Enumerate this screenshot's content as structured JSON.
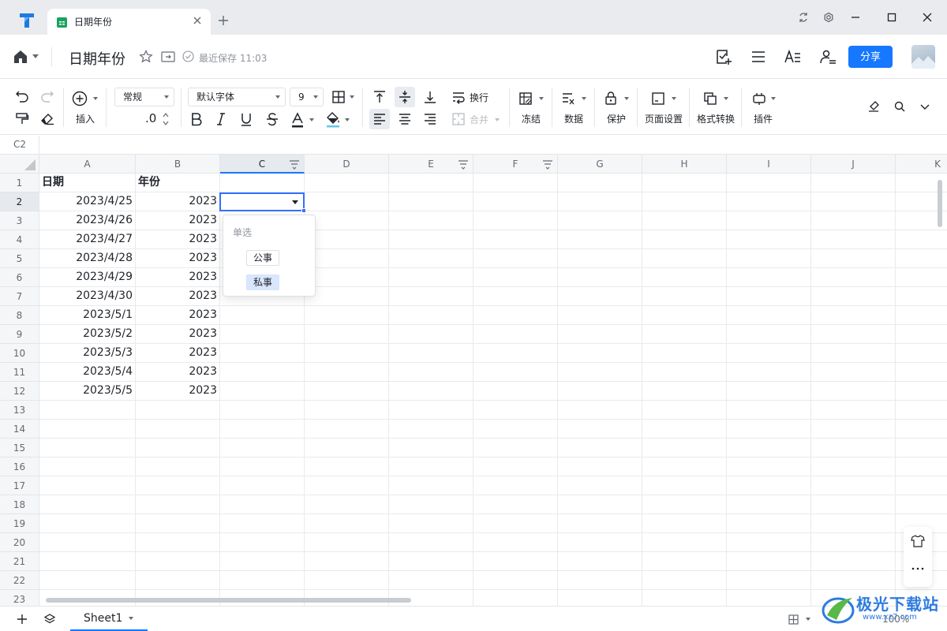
{
  "tab": {
    "title": "日期年份"
  },
  "doc": {
    "title": "日期年份",
    "save_status": "最近保存 11:03",
    "share_label": "分享"
  },
  "toolbar": {
    "insert_label": "插入",
    "number_format": "常规",
    "decimal_label": ".0",
    "font_family": "默认字体",
    "font_size": "9",
    "wrap_label": "换行",
    "merge_label": "合并",
    "freeze_label": "冻结",
    "data_label": "数据",
    "protect_label": "保护",
    "page_setup_label": "页面设置",
    "format_convert_label": "格式转换",
    "plugin_label": "插件"
  },
  "cell_ref": "C2",
  "columns": [
    "A",
    "B",
    "C",
    "D",
    "E",
    "F",
    "G",
    "H",
    "I",
    "J",
    "K"
  ],
  "rows": [
    "1",
    "2",
    "3",
    "4",
    "5",
    "6",
    "7",
    "8",
    "9",
    "10",
    "11",
    "12",
    "13",
    "14",
    "15",
    "16",
    "17",
    "18",
    "19",
    "20",
    "21",
    "22",
    "23"
  ],
  "cells": {
    "A1": "日期",
    "B1": "年份",
    "A2": "2023/4/25",
    "B2": "2023",
    "A3": "2023/4/26",
    "B3": "2023",
    "A4": "2023/4/27",
    "B4": "2023",
    "A5": "2023/4/28",
    "B5": "2023",
    "A6": "2023/4/29",
    "B6": "2023",
    "A7": "2023/4/30",
    "B7": "2023",
    "A8": "2023/5/1",
    "B8": "2023",
    "A9": "2023/5/2",
    "B9": "2023",
    "A10": "2023/5/3",
    "B10": "2023",
    "A11": "2023/5/4",
    "B11": "2023",
    "A12": "2023/5/5",
    "B12": "2023"
  },
  "dropdown": {
    "title": "单选",
    "options": [
      "公事",
      "私事"
    ],
    "highlighted": "私事"
  },
  "sheet": {
    "name": "Sheet1"
  },
  "zoom": "100%",
  "watermark": {
    "text": "极光下载站",
    "url": "www.xz7.com"
  },
  "colors": {
    "accent": "#1677ff",
    "selection": "#3370ff"
  }
}
